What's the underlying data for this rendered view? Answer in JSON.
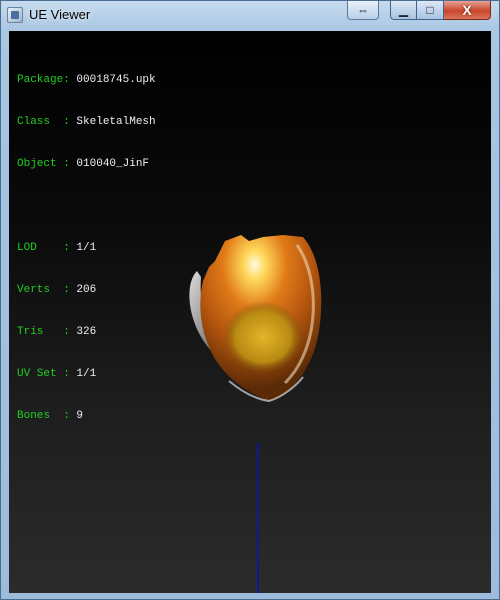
{
  "window": {
    "title": "UE Viewer",
    "controls": {
      "swap_glyph": "⇔",
      "minimize_glyph": "▁",
      "maximize_glyph": "□",
      "close_glyph": "X"
    }
  },
  "info": {
    "object": [
      {
        "key": "Package:",
        "value": "00018745.upk"
      },
      {
        "key": "Class  :",
        "value": "SkeletalMesh"
      },
      {
        "key": "Object :",
        "value": "010040_JinF"
      }
    ],
    "mesh": [
      {
        "key": "LOD    :",
        "value": "1/1"
      },
      {
        "key": "Verts  :",
        "value": "206"
      },
      {
        "key": "Tris   :",
        "value": "326"
      },
      {
        "key": "UV Set :",
        "value": "1/1"
      },
      {
        "key": "Bones  :",
        "value": "9"
      }
    ]
  },
  "colors": {
    "label": "#20d020",
    "value": "#f0f0f0",
    "axis": "#0a1a9a"
  }
}
